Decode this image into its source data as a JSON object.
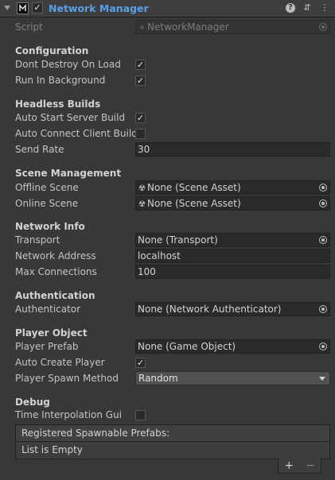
{
  "header": {
    "title": "Network Manager",
    "enabled_mark": "✓",
    "help_icon": "?",
    "settings_icon": "⇵",
    "menu_icon": "⋮"
  },
  "script": {
    "label": "Script",
    "value": "NetworkManager"
  },
  "configuration": {
    "title": "Configuration",
    "dont_destroy_label": "Dont Destroy On Load",
    "dont_destroy_mark": "✓",
    "run_bg_label": "Run In Background",
    "run_bg_mark": "✓"
  },
  "headless": {
    "title": "Headless Builds",
    "auto_start_label": "Auto Start Server Build",
    "auto_start_mark": "✓",
    "auto_connect_label": "Auto Connect Client Build",
    "auto_connect_mark": "",
    "send_rate_label": "Send Rate",
    "send_rate_value": "30"
  },
  "scene": {
    "title": "Scene Management",
    "offline_label": "Offline Scene",
    "offline_value": "None (Scene Asset)",
    "online_label": "Online Scene",
    "online_value": "None (Scene Asset)"
  },
  "network": {
    "title": "Network Info",
    "transport_label": "Transport",
    "transport_value": "None (Transport)",
    "address_label": "Network Address",
    "address_value": "localhost",
    "max_conn_label": "Max Connections",
    "max_conn_value": "100"
  },
  "auth": {
    "title": "Authentication",
    "auth_label": "Authenticator",
    "auth_value": "None (Network Authenticator)"
  },
  "player": {
    "title": "Player Object",
    "prefab_label": "Player Prefab",
    "prefab_value": "None (Game Object)",
    "auto_create_label": "Auto Create Player",
    "auto_create_mark": "✓",
    "spawn_method_label": "Player Spawn Method",
    "spawn_method_value": "Random"
  },
  "debug": {
    "title": "Debug",
    "time_interp_label": "Time Interpolation Gui",
    "time_interp_mark": ""
  },
  "spawnables": {
    "header": "Registered Spawnable Prefabs:",
    "empty_text": "List is Empty",
    "add_label": "+",
    "remove_label": "−"
  },
  "icons": {
    "scene_asset": "scene-asset-icon",
    "script_asset": "script-asset-icon",
    "object_picker": "object-picker-icon"
  }
}
